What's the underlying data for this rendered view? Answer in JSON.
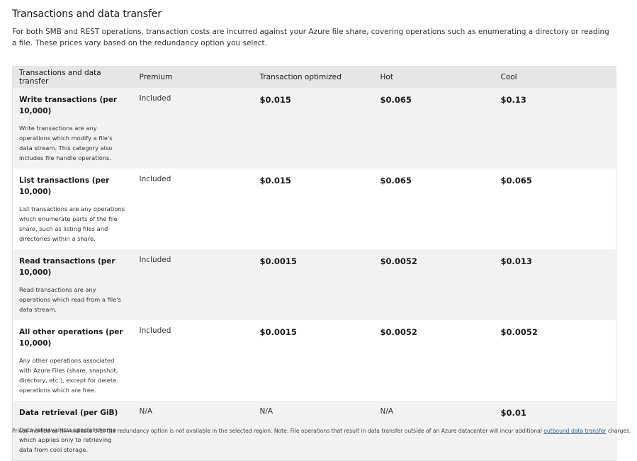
{
  "section": {
    "title": "Transactions and data transfer",
    "description": "For both SMB and REST operations, transaction costs are incurred against your Azure file share, covering operations such as enumerating a directory or reading a file. These prices vary based on the redundancy option you select."
  },
  "table": {
    "headers": [
      "Transactions and data transfer",
      "Premium",
      "Transaction optimized",
      "Hot",
      "Cool"
    ],
    "rows": [
      {
        "title": "Write transactions (per 10,000)",
        "desc": "Write transactions are any operations which modify a file's data stream. This category also includes file handle operations.",
        "premium": "Included",
        "transaction_optimized": "$0.015",
        "hot": "$0.065",
        "cool": "$0.13"
      },
      {
        "title": "List transactions (per 10,000)",
        "desc": "List transactions are any operations which enumerate parts of the file share, such as listing files and directories within a share.",
        "premium": "Included",
        "transaction_optimized": "$0.015",
        "hot": "$0.065",
        "cool": "$0.065"
      },
      {
        "title": "Read transactions (per 10,000)",
        "desc": "Read transactions are any operations which read from a file's data stream.",
        "premium": "Included",
        "transaction_optimized": "$0.0015",
        "hot": "$0.0052",
        "cool": "$0.013"
      },
      {
        "title": "All other operations (per 10,000)",
        "desc": "Any other operations associated with Azure Files (share, snapshot, directory, etc.), except for delete operations which are free.",
        "premium": "Included",
        "transaction_optimized": "$0.0015",
        "hot": "$0.0052",
        "cool": "$0.0052"
      },
      {
        "title": "Data retrieval (per GiB)",
        "desc": "Data retrieval is a special charge which applies only to retrieving data from cool storage.",
        "premium": "N/A",
        "transaction_optimized": "N/A",
        "hot": "N/A",
        "cool": "$0.01"
      }
    ]
  },
  "footnote": {
    "text_before": "Prices marked as N/A indicate that the redundancy option is not available in the selected region. Note: File operations that result in data transfer outside of an Azure datacenter will incur additional ",
    "link_label": "outbound data transfer",
    "text_after": " charges."
  }
}
